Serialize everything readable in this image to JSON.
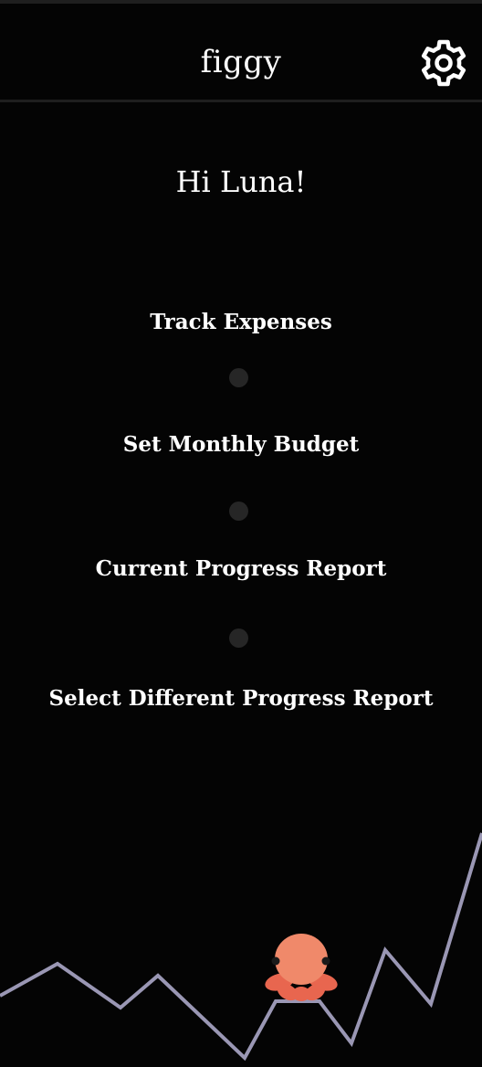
{
  "app": {
    "title": "figgy",
    "settings_icon": "gear-icon"
  },
  "greeting": "Hi Luna!",
  "menu": {
    "items": [
      {
        "label": "Track Expenses"
      },
      {
        "label": "Set Monthly Budget"
      },
      {
        "label": "Current Progress Report"
      },
      {
        "label": "Select Different Progress Report"
      }
    ]
  },
  "colors": {
    "background": "#040404",
    "text": "#ffffff",
    "divider_dot": "#262626",
    "line": "#9a97b4",
    "mascot": "#f0896a"
  },
  "decor": {
    "mascot_icon": "octopus-mascot-icon",
    "line_icon": "progress-line-graphic"
  }
}
